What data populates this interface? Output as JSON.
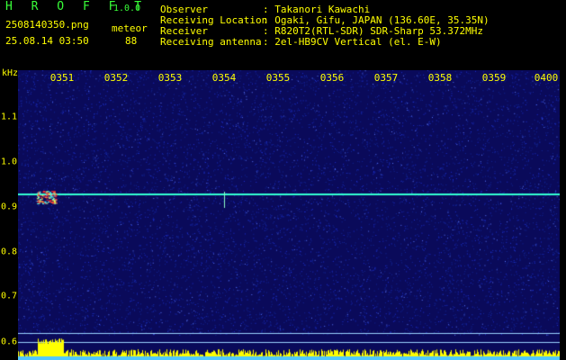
{
  "app": {
    "name": "H R O F F T",
    "version": "1.0.0"
  },
  "file": {
    "name": "2508140350.png",
    "datetime": "25.08.14 03:50"
  },
  "detection": {
    "label": "meteor",
    "count": "88"
  },
  "station": [
    {
      "key": "Observer",
      "value": ": Takanori Kawachi"
    },
    {
      "key": "Receiving Location",
      "value": ": Ogaki, Gifu, JAPAN (136.60E, 35.35N)"
    },
    {
      "key": "Receiver",
      "value": ": R820T2(RTL-SDR) SDR-Sharp 53.372MHz"
    },
    {
      "key": "Receiving antenna",
      "value": ": 2el-HB9CV Vertical (el. E-W)"
    }
  ],
  "spectrogram": {
    "unit_label": "kHz",
    "time_labels": [
      "0351",
      "0352",
      "0353",
      "0354",
      "0355",
      "0356",
      "0357",
      "0358",
      "0359",
      "0400"
    ],
    "freq_labels": [
      "1.1",
      "1.0",
      "0.9",
      "0.8",
      "0.7",
      "0.6"
    ],
    "carrier_khz": 0.93,
    "meteor_time_min": 0.7,
    "colors": {
      "background": "#0a0a5a",
      "noise": "#1e32d2",
      "signal": "#32ffd2",
      "meteor": "#ff3232",
      "amplitude": "#ffff00"
    }
  }
}
